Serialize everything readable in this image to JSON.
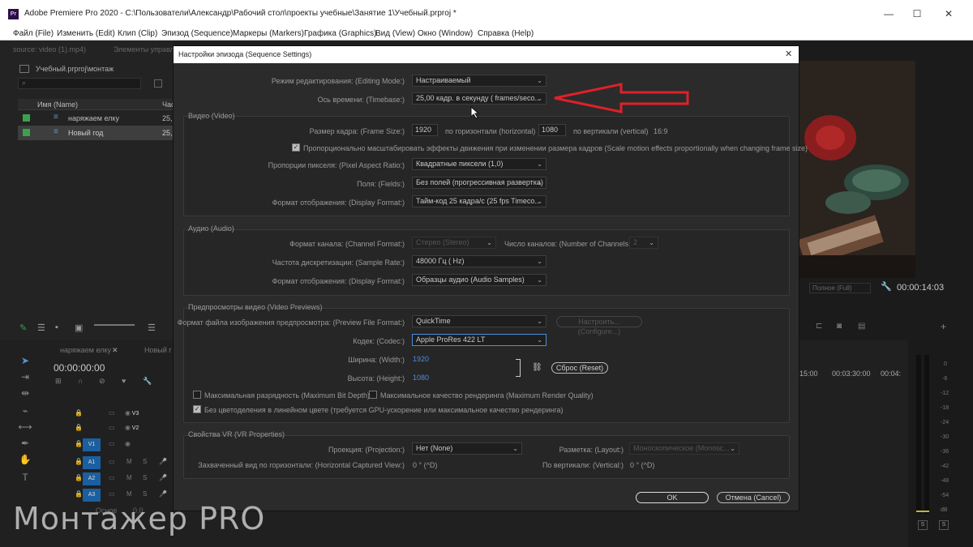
{
  "app": {
    "logo": "Pr",
    "title": "Adobe Premiere Pro 2020 - C:\\Пользователи\\Александр\\Рабочий стол\\проекты учебные\\Занятие 1\\Учебный.prproj *",
    "minimize": "—",
    "maximize": "☐",
    "close": "✕"
  },
  "menu": [
    "Файл (File)",
    "Изменить (Edit)",
    "Клип (Clip)",
    "Эпизод (Sequence)",
    "Маркеры (Markers)",
    "Графика (Graphics)",
    "Вид (View)",
    "Окно (Window)",
    "Справка (Help)"
  ],
  "project": {
    "tab1": "source: video (1).mp4)",
    "tab2": "Элементы управле",
    "path": "Учебный.prproj\\монтаж",
    "col_name": "Имя (Name)",
    "col_rate": "Час",
    "items": [
      {
        "name": "наряжаем елку",
        "rate": "25,",
        "color": "#3aa34a"
      },
      {
        "name": "Новый год",
        "rate": "25,",
        "color": "#3aa34a"
      }
    ]
  },
  "program": {
    "fit": "Полное (Full)",
    "timecode": "00:00:14:03"
  },
  "timeline": {
    "tab1": "наряжаем елку",
    "tab2": "Новый г",
    "timecode": "00:00:00:00",
    "ruler": [
      "15:00",
      "00:03:30:00",
      "00:04:"
    ],
    "tracks": [
      {
        "name": "V3",
        "on": false
      },
      {
        "name": "V2",
        "on": false
      },
      {
        "name": "V1",
        "on": true
      },
      {
        "name": "A1",
        "on": true
      },
      {
        "name": "A2",
        "on": true
      },
      {
        "name": "A3",
        "on": true
      }
    ],
    "master": "Основ",
    "master_val": "0.0"
  },
  "meters": {
    "scale": [
      "0",
      "-6",
      "-12",
      "-18",
      "-24",
      "-30",
      "-36",
      "-42",
      "-48",
      "-54",
      "dB"
    ],
    "solo": "S",
    "solo2": "S"
  },
  "dialog": {
    "title": "Настройки эпизода (Sequence Settings)",
    "editing_mode_label": "Режим редактирования: (Editing Mode:)",
    "editing_mode": "Настраиваемый",
    "timebase_label": "Ось времени: (Timebase:)",
    "timebase": "25,00  кадр. в секунду ( frames/seco...",
    "video_section": "Видео (Video)",
    "frame_size_label": "Размер кадра: (Frame Size:)",
    "frame_w": "1920",
    "horizontal": "по горизонтали (horizontal)",
    "frame_h": "1080",
    "vertical": "по вертикали (vertical)",
    "aspect": "16:9",
    "scale_motion": "Пропорционально масштабировать эффекты движения при изменении размера кадров (Scale motion effects proportionally when changing frame size)",
    "par_label": "Пропорции пикселя: (Pixel Aspect Ratio:)",
    "par": "Квадратные пиксели (1,0)",
    "fields_label": "Поля: (Fields:)",
    "fields": "Без полей (прогрессивная развертка)",
    "vdisplay_label": "Формат отображения: (Display Format:)",
    "vdisplay": "Тайм-код 25 кадра/с (25 fps Timeco...",
    "audio_section": "Аудио (Audio)",
    "channel_format_label": "Формат канала: (Channel Format:)",
    "channel_format": "Стерео (Stereo)",
    "num_channels_label": "Число каналов: (Number of Channels:)",
    "num_channels": "2",
    "sample_rate_label": "Частота дискретизации: (Sample Rate:)",
    "sample_rate": "48000 Гц ( Hz)",
    "adisplay_label": "Формат отображения: (Display Format:)",
    "adisplay": "Образцы аудио (Audio Samples)",
    "previews_section": "Предпросмотры видео (Video Previews)",
    "preview_format_label": "Формат файла изображения предпросмотра: (Preview File Format:)",
    "preview_format": "QuickTime",
    "configure": "Настроить... (Configure...)",
    "codec_label": "Кодек: (Codec:)",
    "codec": "Apple ProRes 422 LT",
    "width_label": "Ширина: (Width:)",
    "width": "1920",
    "height_label": "Высота: (Height:)",
    "height": "1080",
    "reset": "Сброс (Reset)",
    "max_bit_depth": "Максимальная разрядность (Maximum Bit Depth)",
    "max_render_quality": "Максимальное качество рендеринга (Maximum Render Quality)",
    "linear_color": "Без цветоделения в линейном цвете (требуется GPU-ускорение или максимальное качество рендеринга)",
    "vr_section": "Свойства VR (VR Properties)",
    "projection_label": "Проекция: (Projection:)",
    "projection": "Нет (None)",
    "layout_label": "Разметка: (Layout:)",
    "layout": "Моноскопическое (Monosc...",
    "hcaptured_label": "Захваченный вид по горизонтали: (Horizontal Captured View:)",
    "hcaptured": "0 ° (^D)",
    "vertical_label": "По вертикали: (Vertical:)",
    "vertical_val": "0 ° (^D)",
    "ok": "OK",
    "cancel": "Отмена (Cancel)",
    "close": "✕"
  },
  "watermark": "Монтажер PRO",
  "colors": {
    "arrow": "#e0202a",
    "accent": "#4d8ddb",
    "track_on": "#1b5fa0"
  }
}
